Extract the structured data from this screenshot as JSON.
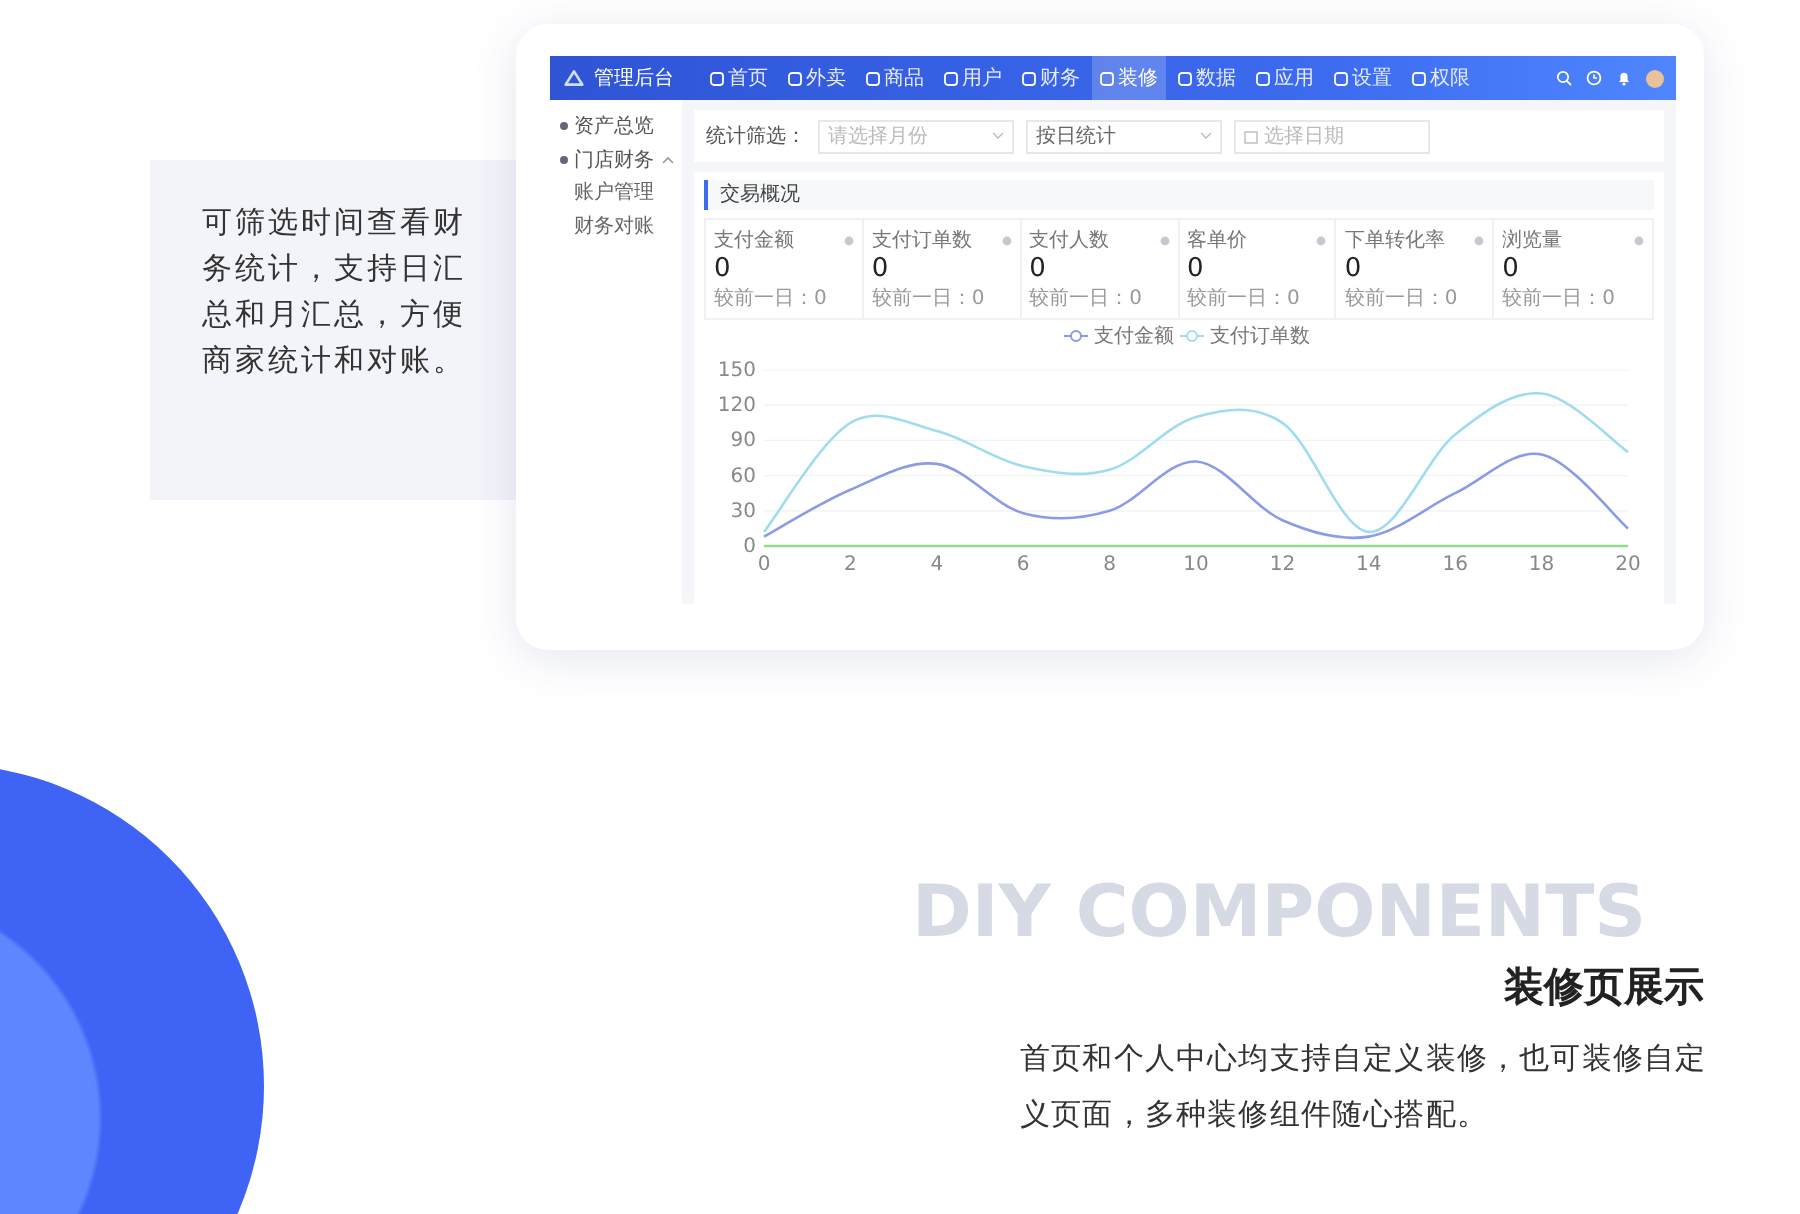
{
  "intro": {
    "text": "可筛选时间查看财务统计，支持日汇总和月汇总，方便商家统计和对账。"
  },
  "app": {
    "brand": "管理后台",
    "nav": [
      {
        "label": "首页",
        "selected": false
      },
      {
        "label": "外卖",
        "selected": false
      },
      {
        "label": "商品",
        "selected": false
      },
      {
        "label": "用户",
        "selected": false
      },
      {
        "label": "财务",
        "selected": false
      },
      {
        "label": "装修",
        "selected": true
      },
      {
        "label": "数据",
        "selected": false
      },
      {
        "label": "应用",
        "selected": false
      },
      {
        "label": "设置",
        "selected": false
      },
      {
        "label": "权限",
        "selected": false
      }
    ],
    "sidebar": [
      {
        "label": "资产总览",
        "kind": "link"
      },
      {
        "label": "门店财务",
        "kind": "group",
        "expanded": true,
        "children": [
          {
            "label": "账户管理"
          },
          {
            "label": "财务对账"
          }
        ]
      }
    ],
    "filter": {
      "label": "统计筛选：",
      "fields": [
        {
          "kind": "select",
          "placeholder": "请选择月份"
        },
        {
          "kind": "select",
          "value": "按日统计"
        },
        {
          "kind": "date",
          "placeholder": "选择日期"
        }
      ]
    },
    "section_title": "交易概况",
    "stats": [
      {
        "label": "支付金额",
        "value": "0",
        "compare": "较前一日：0"
      },
      {
        "label": "支付订单数",
        "value": "0",
        "compare": "较前一日：0"
      },
      {
        "label": "支付人数",
        "value": "0",
        "compare": "较前一日：0"
      },
      {
        "label": "客单价",
        "value": "0",
        "compare": "较前一日：0"
      },
      {
        "label": "下单转化率",
        "value": "0",
        "compare": "较前一日：0"
      },
      {
        "label": "浏览量",
        "value": "0",
        "compare": "较前一日：0"
      }
    ],
    "chart_data": {
      "type": "line",
      "legend": true,
      "grid": true,
      "xlim": [
        0,
        20
      ],
      "x": [
        0,
        2,
        4,
        6,
        8,
        10,
        12,
        14,
        16,
        18,
        20
      ],
      "xticks": [
        0,
        2,
        4,
        6,
        8,
        10,
        12,
        14,
        16,
        18,
        20
      ],
      "yticks": [
        0,
        30,
        60,
        90,
        120,
        150
      ],
      "ylim": [
        0,
        150
      ],
      "series": [
        {
          "name": "支付金额",
          "color": "#8c9be6",
          "values": [
            8,
            48,
            70,
            28,
            30,
            72,
            22,
            8,
            45,
            78,
            15
          ]
        },
        {
          "name": "支付订单数",
          "color": "#9fdcf0",
          "values": [
            12,
            105,
            98,
            68,
            65,
            110,
            105,
            12,
            95,
            130,
            80
          ]
        },
        {
          "color": "#8fdc8a",
          "values": [
            0,
            0,
            0,
            0,
            0,
            0,
            0,
            0,
            0,
            0,
            0
          ]
        }
      ]
    }
  },
  "feature": {
    "background_heading": "DIY COMPONENTS",
    "title": "装修页展示",
    "description": "首页和个人中心均支持自定义装修，也可装修自定义页面，多种装修组件随心搭配。"
  }
}
